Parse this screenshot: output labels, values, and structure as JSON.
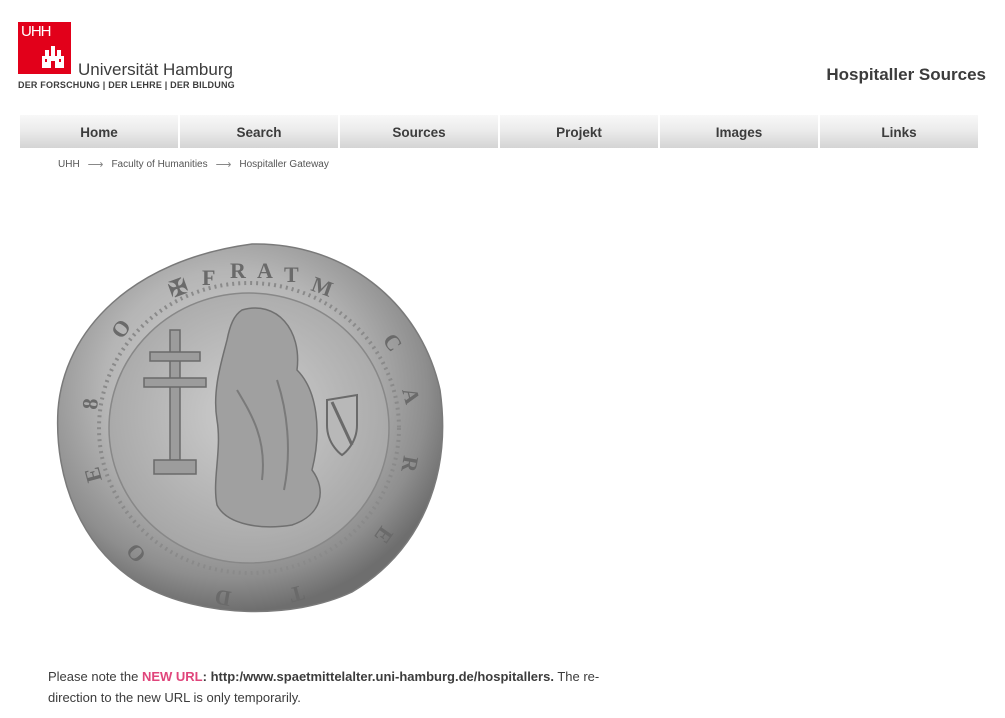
{
  "logo": {
    "mark_text": "UHH",
    "name": "Universität Hamburg",
    "tagline": "DER FORSCHUNG | DER LEHRE | DER BILDUNG",
    "brand_color": "#e2001a"
  },
  "site_title": "Hospitaller Sources",
  "nav": {
    "items": [
      {
        "label": "Home"
      },
      {
        "label": "Search"
      },
      {
        "label": "Sources"
      },
      {
        "label": "Projekt"
      },
      {
        "label": "Images"
      },
      {
        "label": "Links"
      }
    ]
  },
  "breadcrumb": {
    "items": [
      {
        "label": "UHH"
      },
      {
        "label": "Faculty of Humanities"
      },
      {
        "label": "Hospitaller Gateway"
      }
    ],
    "separator": "⟶"
  },
  "image": {
    "icon": "silver-coin-image"
  },
  "notice": {
    "prefix": "Please note the ",
    "new_url_label": "NEW URL",
    "colon": ": ",
    "url": "http:/www.spaetmittelalter.uni-hamburg.de/hospitallers.",
    "suffix": " The re-direction to the new URL is only temporarily.",
    "highlight_color": "#e0457b"
  }
}
